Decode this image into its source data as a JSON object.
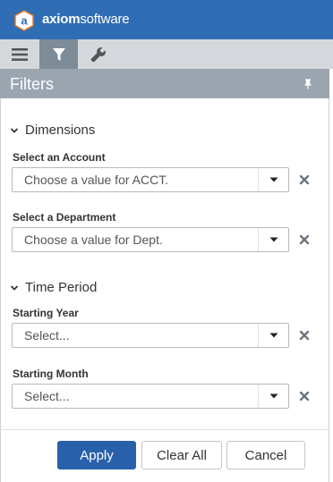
{
  "app": {
    "brand_prefix": "axiom",
    "brand_suffix": "software",
    "logo_letter": "a"
  },
  "tabs": [
    {
      "name": "menu",
      "icon": "hamburger-icon"
    },
    {
      "name": "filter",
      "icon": "filter-icon",
      "active": true
    },
    {
      "name": "tools",
      "icon": "wrench-icon"
    }
  ],
  "panel": {
    "title": "Filters"
  },
  "sections": {
    "dimensions": {
      "title": "Dimensions",
      "fields": [
        {
          "label": "Select an Account",
          "placeholder": "Choose a value for ACCT."
        },
        {
          "label": "Select a Department",
          "placeholder": "Choose a value for Dept."
        }
      ]
    },
    "time": {
      "title": "Time Period",
      "fields": [
        {
          "label": "Starting Year",
          "placeholder": "Select..."
        },
        {
          "label": "Starting Month",
          "placeholder": "Select..."
        }
      ]
    }
  },
  "buttons": {
    "apply": "Apply",
    "clear": "Clear All",
    "cancel": "Cancel"
  },
  "colors": {
    "topbar": "#2f6db4",
    "primary": "#2960ab",
    "header": "#9aa5b0"
  }
}
